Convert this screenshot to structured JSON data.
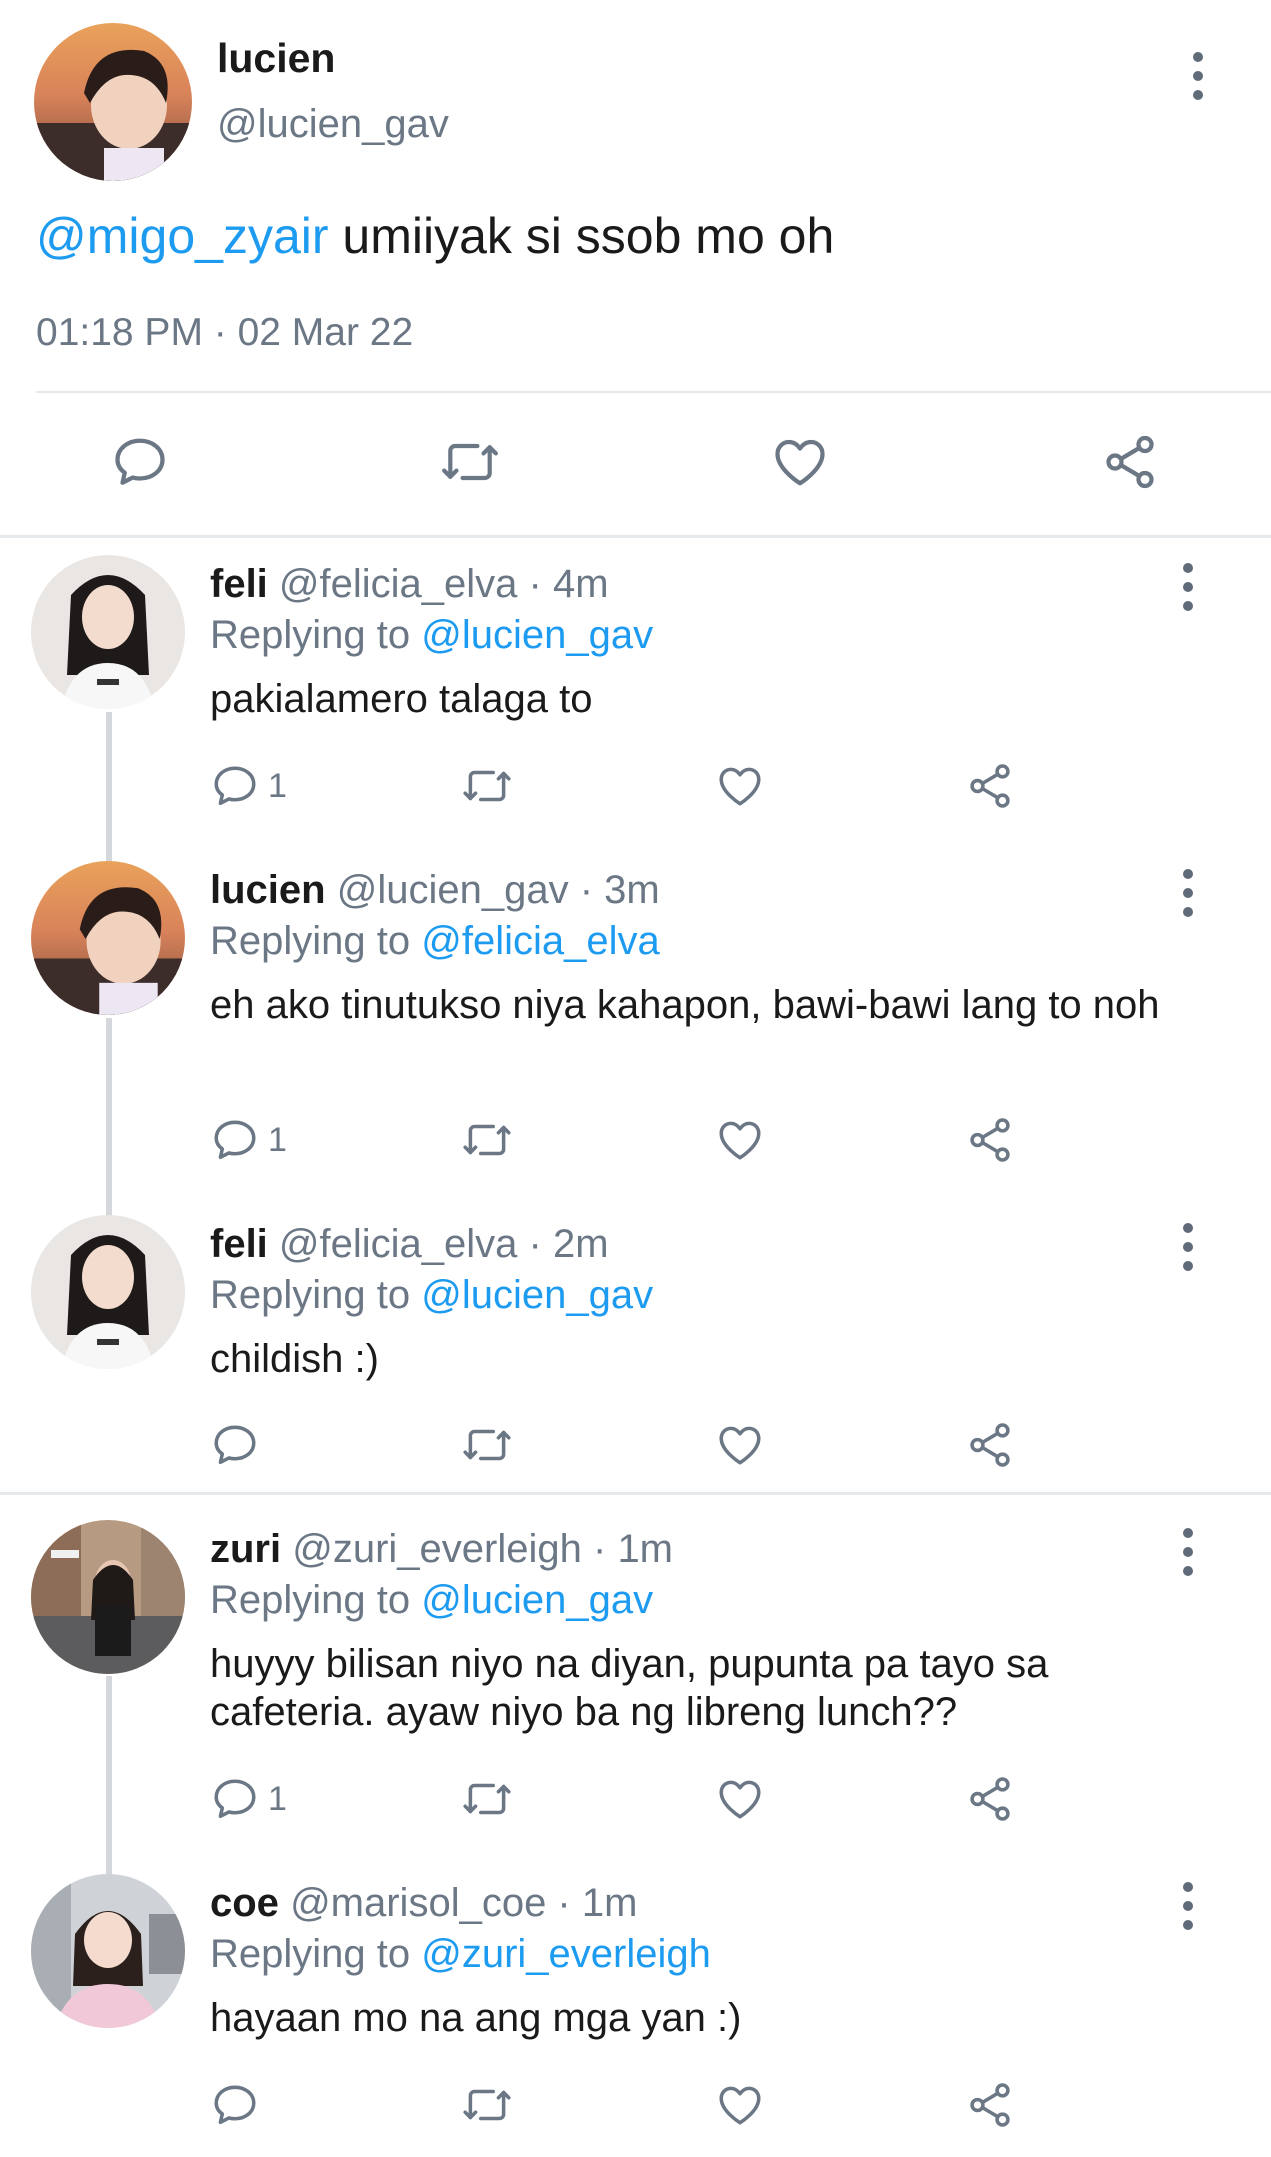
{
  "main_tweet": {
    "name": "lucien",
    "handle": "@lucien_gav",
    "mention": "@migo_zyair",
    "text": " umiiyak si ssob mo oh",
    "timestamp": "01:18 PM · 02 Mar 22",
    "actions": [
      "reply-icon",
      "retweet-icon",
      "like-icon",
      "share-icon"
    ]
  },
  "replies": [
    {
      "name": "feli",
      "handle": "@felicia_elva",
      "age": " · 4m",
      "replying_prefix": "Replying to ",
      "replying_to": "@lucien_gav",
      "text": "pakialamero talaga to",
      "reply_count": "1"
    },
    {
      "name": "lucien",
      "handle": "@lucien_gav",
      "age": " · 3m",
      "replying_prefix": "Replying to ",
      "replying_to": "@felicia_elva",
      "text": "eh ako tinutukso niya kahapon, bawi-bawi lang to noh",
      "reply_count": "1"
    },
    {
      "name": "feli",
      "handle": "@felicia_elva",
      "age": " · 2m",
      "replying_prefix": "Replying to ",
      "replying_to": "@lucien_gav",
      "text": "childish :)",
      "reply_count": ""
    },
    {
      "name": "zuri",
      "handle": "@zuri_everleigh",
      "age": " · 1m",
      "replying_prefix": "Replying to ",
      "replying_to": "@lucien_gav",
      "text": "huyyy bilisan niyo na diyan, pupunta pa tayo sa cafeteria. ayaw niyo ba ng libreng lunch??",
      "reply_count": "1"
    },
    {
      "name": "coe",
      "handle": "@marisol_coe",
      "age": " · 1m",
      "replying_prefix": "Replying to ",
      "replying_to": "@zuri_everleigh",
      "text": "hayaan mo na ang mga yan :)",
      "reply_count": ""
    }
  ],
  "colors": {
    "link": "#1d9bf0",
    "muted": "#6b7785",
    "divider": "#e6e9ec",
    "thread_line": "#d4d8dc"
  }
}
